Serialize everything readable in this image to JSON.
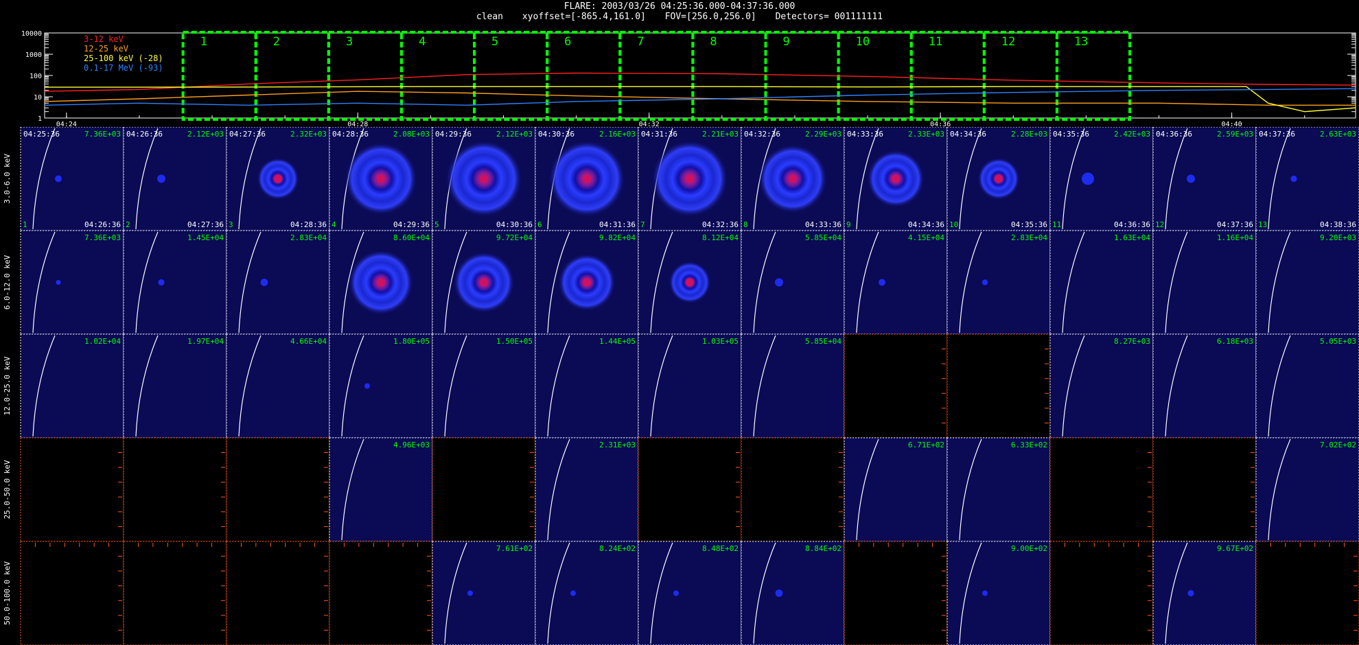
{
  "header": {
    "title": "FLARE: 2003/03/26 04:25:36.000-04:37:36.000",
    "mode": "clean",
    "xyoffset": "xyoffset=[-865.4,161.0]",
    "fov": "FOV=[256.0,256.0]",
    "detectors": "Detectors= 001111111"
  },
  "colors": {
    "bg": "#000000",
    "axis": "#ffffff",
    "box": "#00ff00",
    "counts": "#00ff00",
    "empty_axis": "#ff5a1a",
    "image_bg": "#0a0a55",
    "limb": "#ffffff"
  },
  "chart_data": [
    {
      "type": "line",
      "scale_y": "log",
      "ylim": [
        1,
        10000
      ],
      "yticks": [
        "10000",
        "1000",
        "100",
        "10",
        "1"
      ],
      "xticks": [
        "04:24",
        "04:28",
        "04:32",
        "04:36",
        "04:40"
      ],
      "x_minutes_range": [
        23.7,
        41.7
      ],
      "legend_placement": "top-left",
      "series": [
        {
          "name": "3-12 keV",
          "color": "#ff2020",
          "points": [
            [
              23.7,
              18
            ],
            [
              25.0,
              22
            ],
            [
              26.5,
              40
            ],
            [
              28.0,
              62
            ],
            [
              29.5,
              110
            ],
            [
              31.0,
              130
            ],
            [
              33.0,
              120
            ],
            [
              35.0,
              90
            ],
            [
              37.0,
              60
            ],
            [
              39.0,
              45
            ],
            [
              40.5,
              38
            ],
            [
              41.7,
              35
            ]
          ]
        },
        {
          "name": "12-25 keV",
          "color": "#ffa020",
          "points": [
            [
              23.7,
              6
            ],
            [
              25.0,
              8
            ],
            [
              26.5,
              12
            ],
            [
              28.0,
              18
            ],
            [
              29.5,
              15
            ],
            [
              31.0,
              11
            ],
            [
              33.0,
              8
            ],
            [
              35.0,
              6
            ],
            [
              37.0,
              5
            ],
            [
              39.0,
              5
            ],
            [
              40.5,
              4
            ],
            [
              41.7,
              4
            ]
          ]
        },
        {
          "name": "25-100 keV (-28)",
          "color": "#ffff30",
          "points": [
            [
              23.7,
              28
            ],
            [
              25.0,
              28
            ],
            [
              27.0,
              29
            ],
            [
              29.0,
              30
            ],
            [
              31.0,
              30
            ],
            [
              33.0,
              30
            ],
            [
              35.0,
              29
            ],
            [
              37.0,
              30
            ],
            [
              39.0,
              30
            ],
            [
              40.2,
              30
            ],
            [
              40.5,
              5
            ],
            [
              41.0,
              2
            ],
            [
              41.7,
              3
            ]
          ]
        },
        {
          "name": "0.1-17 MeV (-93)",
          "color": "#3080ff",
          "points": [
            [
              23.7,
              4
            ],
            [
              25.0,
              5
            ],
            [
              26.5,
              4
            ],
            [
              28.0,
              5
            ],
            [
              29.5,
              4
            ],
            [
              31.0,
              6
            ],
            [
              33.0,
              8
            ],
            [
              35.0,
              12
            ],
            [
              37.0,
              16
            ],
            [
              39.0,
              20
            ],
            [
              40.5,
              22
            ],
            [
              41.7,
              24
            ]
          ]
        }
      ],
      "intervals": [
        "1",
        "2",
        "3",
        "4",
        "5",
        "6",
        "7",
        "8",
        "9",
        "10",
        "11",
        "12",
        "13"
      ]
    },
    {
      "type": "heatmap",
      "energy_bands": [
        "3.0-6.0 keV",
        "6.0-12.0 keV",
        "12.0-25.0 keV",
        "25.0-50.0 keV",
        "50.0-100.0 keV"
      ],
      "start_times": [
        "04:25:36",
        "04:26:36",
        "04:27:36",
        "04:28:36",
        "04:29:36",
        "04:30:36",
        "04:31:36",
        "04:32:36",
        "04:33:36",
        "04:34:36",
        "04:35:36",
        "04:36:36",
        "04:37:36"
      ],
      "end_times": [
        "04:26:36",
        "04:27:36",
        "04:28:36",
        "04:29:36",
        "04:30:36",
        "04:31:36",
        "04:32:36",
        "04:33:36",
        "04:34:36",
        "04:35:36",
        "04:36:36",
        "04:37:36",
        "04:38:36"
      ],
      "counts": [
        [
          "7.36E+03",
          "2.12E+03",
          "2.32E+03",
          "2.08E+03",
          "2.12E+03",
          "2.16E+03",
          "2.21E+03",
          "2.29E+03",
          "2.33E+03",
          "2.28E+03",
          "2.42E+03",
          "2.59E+03",
          "2.63E+03"
        ],
        [
          "7.36E+03",
          "1.45E+04",
          "2.83E+04",
          "8.60E+04",
          "9.72E+04",
          "9.82E+04",
          "8.12E+04",
          "5.85E+04",
          "4.15E+04",
          "2.83E+04",
          "1.63E+04",
          "1.16E+04",
          "9.20E+03"
        ],
        [
          "1.02E+04",
          "1.97E+04",
          "4.66E+04",
          "1.80E+05",
          "1.50E+05",
          "1.44E+05",
          "1.03E+05",
          "5.85E+04",
          "",
          "",
          "8.27E+03",
          "6.18E+03",
          "5.05E+03"
        ],
        [
          "",
          "",
          "",
          "4.96E+03",
          "",
          "2.31E+03",
          "",
          "",
          "6.71E+02",
          "6.33E+02",
          "",
          "",
          "7.02E+02"
        ],
        [
          "",
          "",
          "",
          "",
          "7.61E+02",
          "8.24E+02",
          "8.48E+02",
          "8.84E+02",
          "",
          "9.00E+02",
          "",
          "9.67E+02",
          ""
        ]
      ],
      "source_levels": [
        [
          0.1,
          0.15,
          0.55,
          0.95,
          1.0,
          1.0,
          1.0,
          0.9,
          0.75,
          0.55,
          0.3,
          0.15,
          0.08
        ],
        [
          0.03,
          0.08,
          0.12,
          0.85,
          0.8,
          0.75,
          0.55,
          0.15,
          0.1,
          0.06,
          0,
          0,
          0
        ],
        [
          0,
          0,
          0,
          0.05,
          0,
          0,
          0,
          0,
          0,
          0,
          0,
          0,
          0
        ],
        [
          0,
          0,
          0,
          0,
          0,
          0,
          0,
          0,
          0,
          0,
          0,
          0,
          0
        ],
        [
          0,
          0,
          0,
          0,
          0.05,
          0.05,
          0.05,
          0.12,
          0,
          0.05,
          0,
          0.08,
          0
        ]
      ],
      "panel_numbers": [
        "1",
        "2",
        "3",
        "4",
        "5",
        "6",
        "7",
        "8",
        "9",
        "10",
        "11",
        "12",
        "13"
      ]
    }
  ]
}
